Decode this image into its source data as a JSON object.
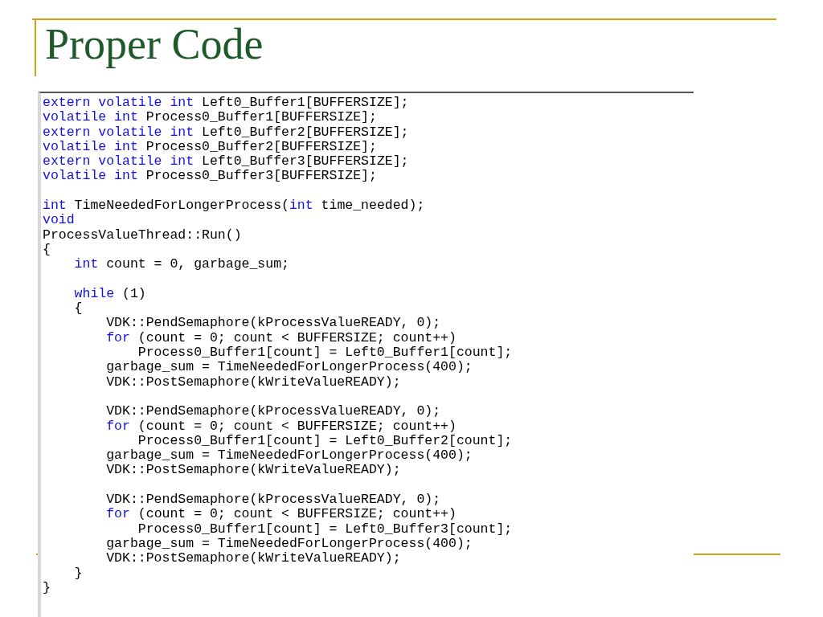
{
  "slide": {
    "title": "Proper Code"
  },
  "code": {
    "lines": [
      {
        "kind": "code",
        "segments": [
          {
            "kind": "keyword",
            "text": "extern volatile int"
          },
          {
            "kind": "plain",
            "text": " Left0_Buffer1[BUFFERSIZE];"
          }
        ]
      },
      {
        "kind": "code",
        "segments": [
          {
            "kind": "keyword",
            "text": "volatile int"
          },
          {
            "kind": "plain",
            "text": " Process0_Buffer1[BUFFERSIZE];"
          }
        ]
      },
      {
        "kind": "code",
        "segments": [
          {
            "kind": "keyword",
            "text": "extern volatile int"
          },
          {
            "kind": "plain",
            "text": " Left0_Buffer2[BUFFERSIZE];"
          }
        ]
      },
      {
        "kind": "code",
        "segments": [
          {
            "kind": "keyword",
            "text": "volatile int"
          },
          {
            "kind": "plain",
            "text": " Process0_Buffer2[BUFFERSIZE];"
          }
        ]
      },
      {
        "kind": "code",
        "segments": [
          {
            "kind": "keyword",
            "text": "extern volatile int"
          },
          {
            "kind": "plain",
            "text": " Left0_Buffer3[BUFFERSIZE];"
          }
        ]
      },
      {
        "kind": "code",
        "segments": [
          {
            "kind": "keyword",
            "text": "volatile int"
          },
          {
            "kind": "plain",
            "text": " Process0_Buffer3[BUFFERSIZE];"
          }
        ]
      },
      {
        "kind": "blank"
      },
      {
        "kind": "code",
        "segments": [
          {
            "kind": "keyword",
            "text": "int"
          },
          {
            "kind": "plain",
            "text": " TimeNeededForLongerProcess("
          },
          {
            "kind": "keyword",
            "text": "int"
          },
          {
            "kind": "plain",
            "text": " time_needed);"
          }
        ]
      },
      {
        "kind": "code",
        "segments": [
          {
            "kind": "keyword",
            "text": "void"
          }
        ]
      },
      {
        "kind": "code",
        "segments": [
          {
            "kind": "plain",
            "text": "ProcessValueThread::Run()"
          }
        ]
      },
      {
        "kind": "code",
        "segments": [
          {
            "kind": "plain",
            "text": "{"
          }
        ]
      },
      {
        "kind": "code",
        "segments": [
          {
            "kind": "keyword",
            "text": "    int"
          },
          {
            "kind": "plain",
            "text": " count = 0, garbage_sum;"
          }
        ]
      },
      {
        "kind": "blank"
      },
      {
        "kind": "code",
        "segments": [
          {
            "kind": "keyword",
            "text": "    while"
          },
          {
            "kind": "plain",
            "text": " (1)"
          }
        ]
      },
      {
        "kind": "code",
        "segments": [
          {
            "kind": "plain",
            "text": "    {"
          }
        ]
      },
      {
        "kind": "code",
        "segments": [
          {
            "kind": "plain",
            "text": "        VDK::PendSemaphore(kProcessValueREADY, 0);"
          }
        ]
      },
      {
        "kind": "code",
        "segments": [
          {
            "kind": "keyword",
            "text": "        for"
          },
          {
            "kind": "plain",
            "text": " (count = 0; count < BUFFERSIZE; count++)"
          }
        ]
      },
      {
        "kind": "code",
        "segments": [
          {
            "kind": "plain",
            "text": "            Process0_Buffer1[count] = Left0_Buffer1[count];"
          }
        ]
      },
      {
        "kind": "code",
        "segments": [
          {
            "kind": "plain",
            "text": "        garbage_sum = TimeNeededForLongerProcess(400);"
          }
        ]
      },
      {
        "kind": "code",
        "segments": [
          {
            "kind": "plain",
            "text": "        VDK::PostSemaphore(kWriteValueREADY);"
          }
        ]
      },
      {
        "kind": "blank"
      },
      {
        "kind": "code",
        "segments": [
          {
            "kind": "plain",
            "text": "        VDK::PendSemaphore(kProcessValueREADY, 0);"
          }
        ]
      },
      {
        "kind": "code",
        "segments": [
          {
            "kind": "keyword",
            "text": "        for"
          },
          {
            "kind": "plain",
            "text": " (count = 0; count < BUFFERSIZE; count++)"
          }
        ]
      },
      {
        "kind": "code",
        "segments": [
          {
            "kind": "plain",
            "text": "            Process0_Buffer1[count] = Left0_Buffer2[count];"
          }
        ]
      },
      {
        "kind": "code",
        "segments": [
          {
            "kind": "plain",
            "text": "        garbage_sum = TimeNeededForLongerProcess(400);"
          }
        ]
      },
      {
        "kind": "code",
        "segments": [
          {
            "kind": "plain",
            "text": "        VDK::PostSemaphore(kWriteValueREADY);"
          }
        ]
      },
      {
        "kind": "blank"
      },
      {
        "kind": "code",
        "segments": [
          {
            "kind": "plain",
            "text": "        VDK::PendSemaphore(kProcessValueREADY, 0);"
          }
        ]
      },
      {
        "kind": "code",
        "segments": [
          {
            "kind": "keyword",
            "text": "        for"
          },
          {
            "kind": "plain",
            "text": " (count = 0; count < BUFFERSIZE; count++)"
          }
        ]
      },
      {
        "kind": "code",
        "segments": [
          {
            "kind": "plain",
            "text": "            Process0_Buffer1[count] = Left0_Buffer3[count];"
          }
        ]
      },
      {
        "kind": "code",
        "segments": [
          {
            "kind": "plain",
            "text": "        garbage_sum = TimeNeededForLongerProcess(400);"
          }
        ]
      },
      {
        "kind": "code",
        "segments": [
          {
            "kind": "plain",
            "text": "        VDK::PostSemaphore(kWriteValueREADY);"
          }
        ]
      },
      {
        "kind": "code",
        "segments": [
          {
            "kind": "plain",
            "text": "    }"
          }
        ]
      },
      {
        "kind": "code",
        "segments": [
          {
            "kind": "plain",
            "text": "}"
          }
        ]
      }
    ]
  }
}
